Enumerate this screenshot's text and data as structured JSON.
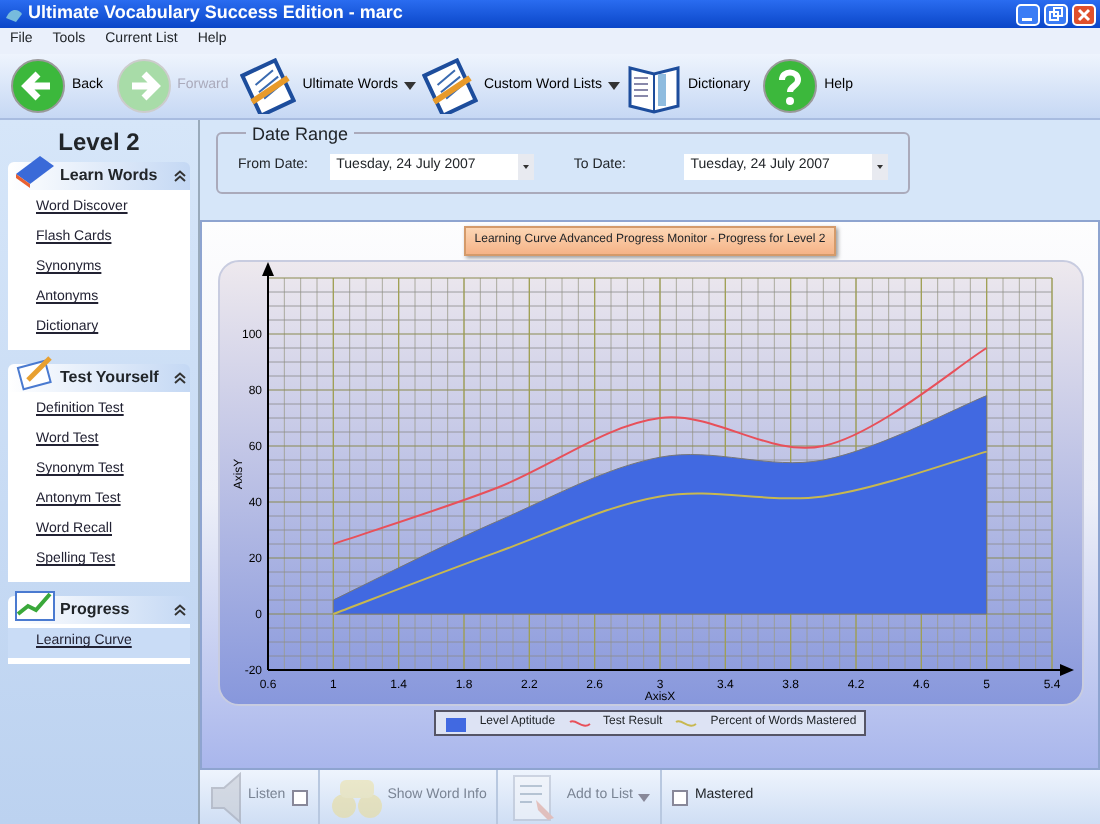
{
  "window": {
    "title": "Ultimate Vocabulary Success Edition - marc"
  },
  "menu": [
    "File",
    "Tools",
    "Current List",
    "Help"
  ],
  "toolbar": [
    {
      "kind": "back",
      "label": "Back",
      "disabled": false,
      "dropdown": false
    },
    {
      "kind": "forward",
      "label": "Forward",
      "disabled": true,
      "dropdown": false
    },
    {
      "kind": "clipboard",
      "label": "Ultimate Words",
      "disabled": false,
      "dropdown": true
    },
    {
      "kind": "clipboard",
      "label": "Custom Word Lists",
      "disabled": false,
      "dropdown": true
    },
    {
      "kind": "book",
      "label": "Dictionary",
      "disabled": false,
      "dropdown": false
    },
    {
      "kind": "help",
      "label": "Help",
      "disabled": false,
      "dropdown": false
    }
  ],
  "sidebar": {
    "heading": "Level 2",
    "groups": [
      {
        "kind": "book",
        "title": "Learn Words",
        "expanded": true,
        "items": [
          {
            "label": "Word Discover",
            "selected": false
          },
          {
            "label": "Flash Cards",
            "selected": false
          },
          {
            "label": "Synonyms",
            "selected": false
          },
          {
            "label": "Antonyms",
            "selected": false
          },
          {
            "label": "Dictionary",
            "selected": false
          }
        ]
      },
      {
        "kind": "pencil",
        "title": "Test Yourself",
        "expanded": true,
        "items": [
          {
            "label": "Definition Test",
            "selected": false
          },
          {
            "label": "Word Test",
            "selected": false
          },
          {
            "label": "Synonym Test",
            "selected": false
          },
          {
            "label": "Antonym Test",
            "selected": false
          },
          {
            "label": "Word Recall",
            "selected": false
          },
          {
            "label": "Spelling Test",
            "selected": false
          }
        ]
      },
      {
        "kind": "chart",
        "title": "Progress",
        "expanded": true,
        "items": [
          {
            "label": "Learning Curve",
            "selected": true
          }
        ]
      }
    ]
  },
  "date_range": {
    "title": "Date Range",
    "from": {
      "label": "From Date:",
      "value": "Tuesday, 24 July 2007"
    },
    "to": {
      "label": "To Date:",
      "value": "Tuesday, 24 July 2007"
    }
  },
  "chart": {
    "badge": "Learning Curve Advanced Progress Monitor - Progress for Level 2",
    "chart_data": {
      "type": "line",
      "xlabel": "AxisX",
      "ylabel": "AxisY",
      "x": [
        1,
        2,
        3,
        4,
        5
      ],
      "xlim": [
        0.6,
        5.4
      ],
      "ylim": [
        -20,
        120
      ],
      "grid": true,
      "xticks": [
        0.6,
        1,
        1.4,
        1.8,
        2.2,
        2.6,
        3,
        3.4,
        3.8,
        4.2,
        4.6,
        5,
        5.4
      ],
      "yticks": [
        -20,
        0,
        20,
        40,
        60,
        80,
        100
      ],
      "series": [
        {
          "name": "Level Aptitude",
          "type": "area",
          "color": "#4169e1",
          "values": [
            5,
            33,
            56,
            55,
            78
          ]
        },
        {
          "name": "Test Result",
          "type": "line",
          "color": "#e8505a",
          "values": [
            25,
            45,
            70,
            60,
            95
          ]
        },
        {
          "name": "Percent of Words Mastered",
          "type": "line",
          "color": "#c8b850",
          "values": [
            0,
            22,
            42,
            42,
            58
          ]
        }
      ]
    }
  },
  "bottom_bar": [
    {
      "kind": "speaker",
      "label": "Listen",
      "disabled": true,
      "checked": false
    },
    {
      "kind": "binoculars",
      "label": "Show Word Info",
      "disabled": true
    },
    {
      "kind": "addlist",
      "label": "Add to List",
      "disabled": true,
      "dropdown": true
    },
    {
      "kind": "checkbox",
      "label": "Mastered",
      "checked": false
    }
  ]
}
